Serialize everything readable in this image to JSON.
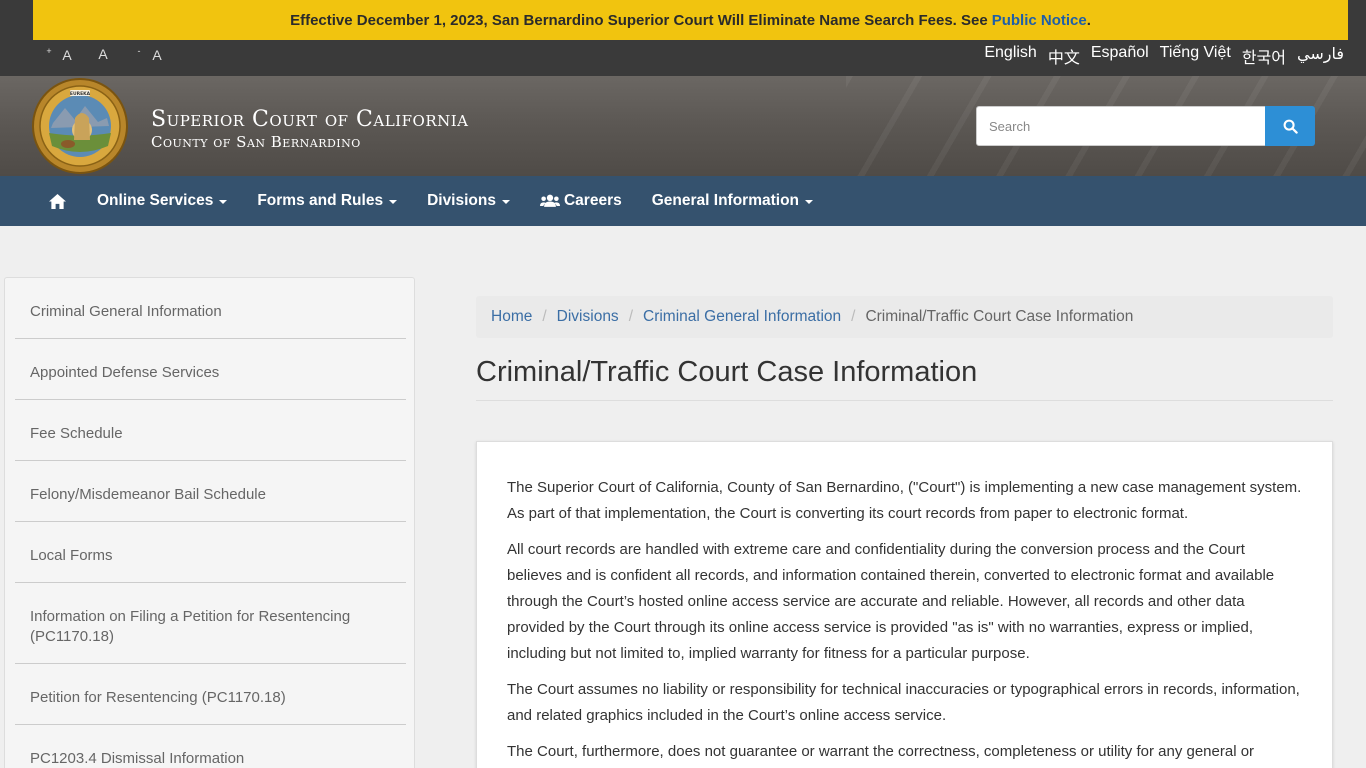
{
  "notice": {
    "text": "Effective December 1, 2023, San Bernardino Superior Court Will Eliminate Name Search Fees. See",
    "link": "Public Notice",
    "end": "."
  },
  "font_sizes": {
    "increase": "A",
    "normal": "A",
    "decrease": "A"
  },
  "languages": [
    "English",
    "中文",
    "Español",
    "Tiếng Việt",
    "한국어",
    "فارسي"
  ],
  "header": {
    "title": "Superior Court of California",
    "subtitle": "County of San Bernardino",
    "search_placeholder": "Search"
  },
  "nav": {
    "items": [
      {
        "label": "Online Services",
        "dropdown": true
      },
      {
        "label": "Forms and Rules",
        "dropdown": true
      },
      {
        "label": "Divisions",
        "dropdown": true
      },
      {
        "label": "Careers",
        "dropdown": false
      },
      {
        "label": "General Information",
        "dropdown": true
      }
    ]
  },
  "sidebar": {
    "items": [
      "Criminal General Information",
      "Appointed Defense Services",
      "Fee Schedule",
      "Felony/Misdemeanor Bail Schedule",
      "Local Forms",
      "Information on Filing a Petition for Resentencing (PC1170.18)",
      "Petition for Resentencing (PC1170.18)",
      "PC1203.4 Dismissal Information"
    ]
  },
  "breadcrumb": {
    "items": [
      "Home",
      "Divisions",
      "Criminal General Information"
    ],
    "active": "Criminal/Traffic Court Case Information"
  },
  "page_title": "Criminal/Traffic Court Case Information",
  "content": {
    "paragraphs": [
      "The Superior Court of California, County of San Bernardino, (\"Court\") is implementing a new case management system. As part of that implementation, the Court is converting its court records from paper to electronic format.",
      "All court records are handled with extreme care and confidentiality during the conversion process and the Court believes and is confident all records, and information contained therein, converted to electronic format and available through the Court’s hosted online access service are accurate and reliable. However, all records and other data provided by the Court through its online access service is provided \"as is\" with no warranties, express or implied, including but not limited to, implied warranty for fitness for a particular purpose.",
      "The Court assumes no liability or responsibility for technical inaccuracies or typographical errors in records, information, and related graphics included in the Court’s online access service.",
      "The Court, furthermore, does not guarantee or warrant the correctness, completeness or utility for any general or"
    ]
  },
  "seal": {
    "text_top": "EUREKA",
    "text_ring": "SUPERIOR COURT OF CALIFORNIA COUNTY OF SAN BERNARDINO"
  },
  "colors": {
    "notice": "#f1c40f",
    "link": "#1f5fa8",
    "nav": "#35526e",
    "search_button": "#2d8fd6"
  }
}
